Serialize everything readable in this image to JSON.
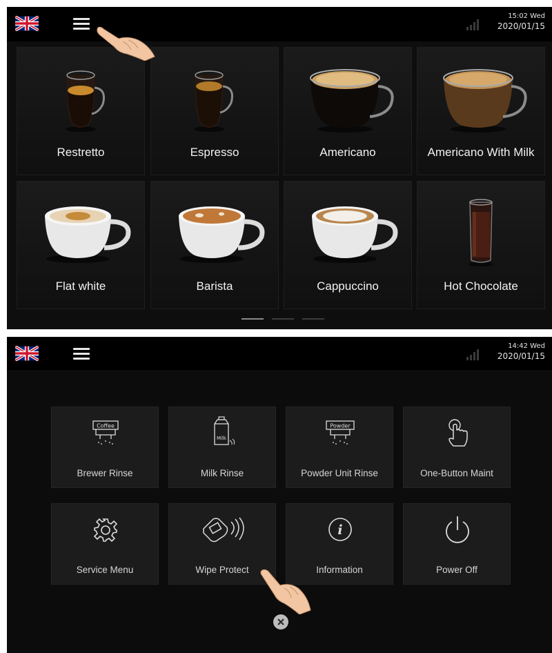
{
  "colors": {
    "screen_bg": "#0e0e0e",
    "tile_bg": "#161616",
    "text": "#f2f2f2",
    "flag_red": "#cf142b",
    "flag_blue": "#00247d"
  },
  "screen1": {
    "status": {
      "language_icon": "uk-flag-icon",
      "menu_icon": "hamburger-menu-icon",
      "signal_icon": "signal-icon",
      "time": "15:02 Wed",
      "date": "2020/01/15"
    },
    "drinks": [
      {
        "label": "Restretto",
        "icon": "restretto-cup-icon"
      },
      {
        "label": "Espresso",
        "icon": "espresso-cup-icon"
      },
      {
        "label": "Americano",
        "icon": "americano-cup-icon"
      },
      {
        "label": "Americano With Milk",
        "icon": "americano-with-milk-cup-icon"
      },
      {
        "label": "Flat white",
        "icon": "flat-white-cup-icon"
      },
      {
        "label": "Barista",
        "icon": "barista-cup-icon"
      },
      {
        "label": "Cappuccino",
        "icon": "cappuccino-cup-icon"
      },
      {
        "label": "Hot Chocolate",
        "icon": "hot-chocolate-glass-icon"
      }
    ]
  },
  "screen2": {
    "status": {
      "language_icon": "uk-flag-icon",
      "menu_icon": "hamburger-menu-icon",
      "signal_icon": "signal-icon",
      "time": "14:42 Wed",
      "date": "2020/01/15"
    },
    "menu_items": [
      {
        "label": "Brewer Rinse",
        "icon": "brewer-rinse-icon",
        "icon_text": "Coffee"
      },
      {
        "label": "Milk Rinse",
        "icon": "milk-rinse-icon",
        "icon_text": "Milk"
      },
      {
        "label": "Powder Unit Rinse",
        "icon": "powder-unit-rinse-icon",
        "icon_text": "Powder"
      },
      {
        "label": "One-Button Maint",
        "icon": "touch-hand-icon"
      },
      {
        "label": "Service Menu",
        "icon": "gear-icon"
      },
      {
        "label": "Wipe Protect",
        "icon": "wipe-hand-icon"
      },
      {
        "label": "Information",
        "icon": "info-icon",
        "icon_text": "i"
      },
      {
        "label": "Power Off",
        "icon": "power-icon"
      }
    ],
    "close_icon": "close-icon"
  }
}
